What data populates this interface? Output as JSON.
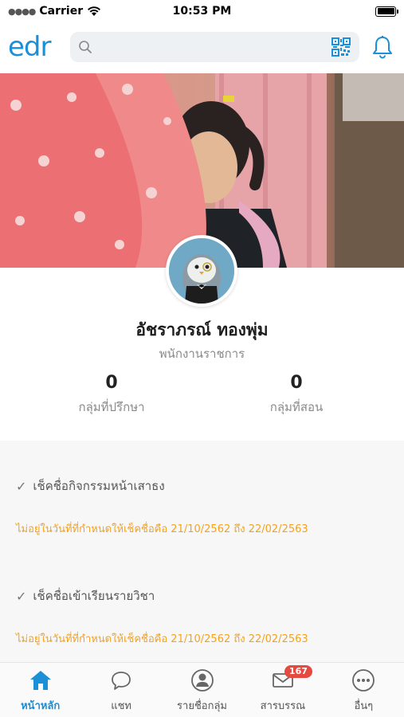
{
  "status_bar": {
    "carrier": "Carrier",
    "time": "10:53 PM"
  },
  "header": {
    "logo": "edr",
    "search_placeholder": "",
    "icons": [
      "search-icon",
      "qr-code-icon",
      "bell-icon"
    ]
  },
  "profile": {
    "name": "อัชราภรณ์ ทองพุ่ม",
    "role": "พนักงานราชการ",
    "stats": [
      {
        "value": "0",
        "label": "กลุ่มที่ปรึกษา"
      },
      {
        "value": "0",
        "label": "กลุ่มที่สอน"
      }
    ]
  },
  "activities": [
    {
      "title": "เช็คชื่อกิจกรรมหน้าเสาธง",
      "note": "ไม่อยู่ในวันที่ที่กำหนดให้เช็คชื่อคือ 21/10/2562 ถึง 22/02/2563"
    },
    {
      "title": "เช็คชื่อเข้าเรียนรายวิชา",
      "note": "ไม่อยู่ในวันที่ที่กำหนดให้เช็คชื่อคือ 21/10/2562 ถึง 22/02/2563"
    }
  ],
  "tabs": [
    {
      "label": "หน้าหลัก",
      "icon": "home-icon",
      "active": true
    },
    {
      "label": "แชท",
      "icon": "chat-icon",
      "active": false
    },
    {
      "label": "รายชื่อกลุ่ม",
      "icon": "user-icon",
      "active": false
    },
    {
      "label": "สารบรรณ",
      "icon": "mail-icon",
      "active": false,
      "badge": "167"
    },
    {
      "label": "อื่นๆ",
      "icon": "more-icon",
      "active": false
    }
  ],
  "colors": {
    "accent": "#1b8fd8",
    "warning": "#f4a21c",
    "badge": "#e5493f"
  }
}
